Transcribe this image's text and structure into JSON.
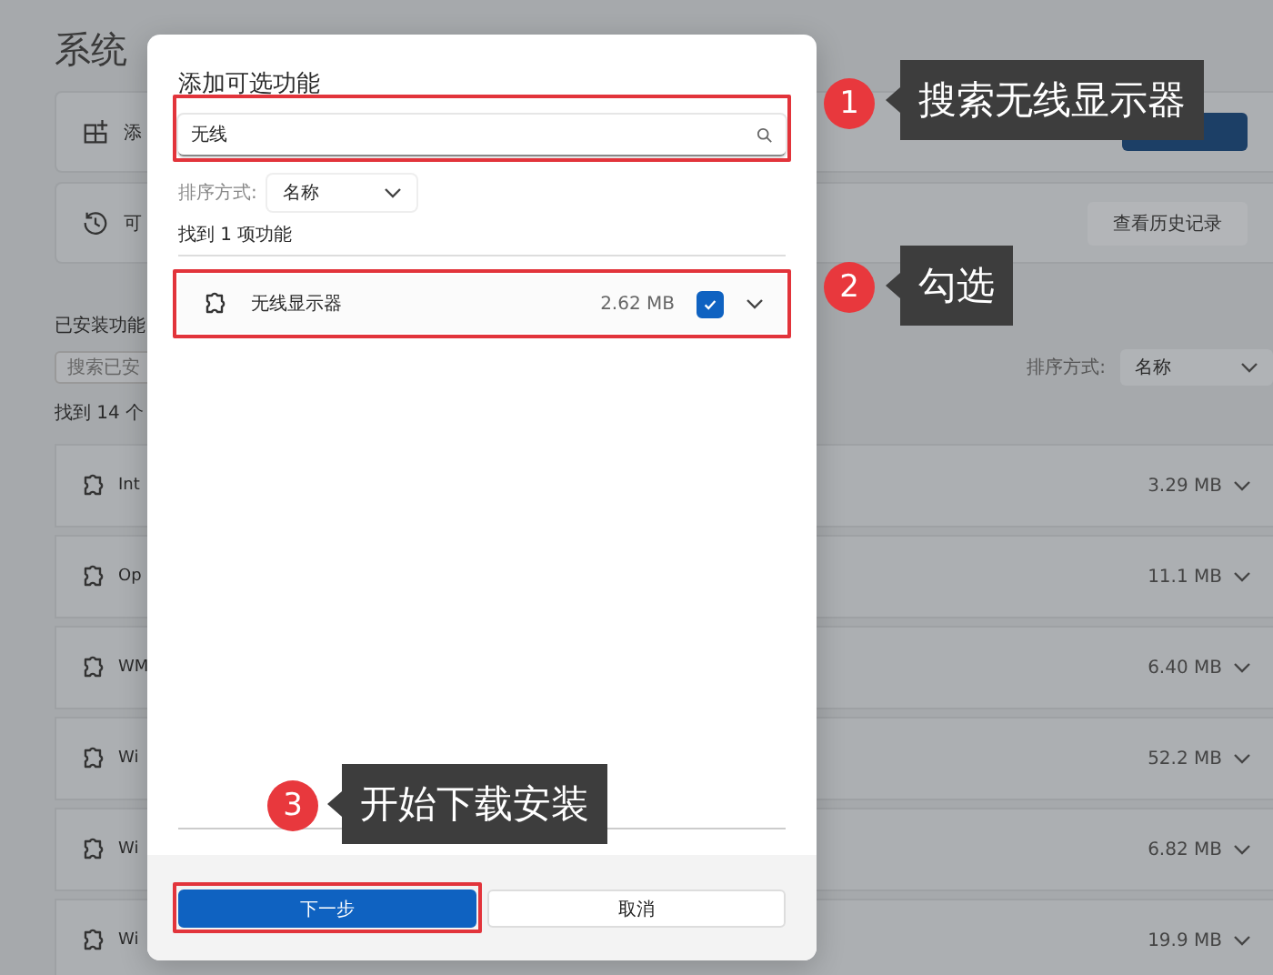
{
  "page": {
    "title": "系统",
    "cards": [
      {
        "kind": "add",
        "label": "添"
      },
      {
        "kind": "history",
        "label": "可",
        "button": "查看历史记录"
      }
    ],
    "installed": {
      "heading": "已安装功能",
      "search_placeholder": "搜索已安",
      "sort_label": "排序方式:",
      "sort_value": "名称",
      "count": "找到 14 个",
      "features": [
        {
          "name": "Int",
          "size": "3.29 MB"
        },
        {
          "name": "Op",
          "size": "11.1 MB"
        },
        {
          "name": "WM",
          "size": "6.40 MB"
        },
        {
          "name": "Wi",
          "size": "52.2 MB"
        },
        {
          "name": "Wi",
          "size": "6.82 MB"
        },
        {
          "name": "Wi",
          "size": "19.9 MB"
        }
      ]
    }
  },
  "dialog": {
    "title": "添加可选功能",
    "search": {
      "value": "无线",
      "highlighted": true
    },
    "sort_label": "排序方式:",
    "sort_value": "名称",
    "count": "找到 1 项功能",
    "results": [
      {
        "name": "无线显示器",
        "size": "2.62 MB",
        "checked": true,
        "highlighted": true
      }
    ],
    "buttons": [
      {
        "label": "下一步",
        "kind": "primary",
        "highlighted": true
      },
      {
        "label": "取消",
        "kind": "secondary",
        "highlighted": false
      }
    ]
  },
  "annotations": [
    {
      "number": "1",
      "text": "搜索无线显示器"
    },
    {
      "number": "2",
      "text": "勾选"
    },
    {
      "number": "3",
      "text": "开始下载安装"
    }
  ]
}
